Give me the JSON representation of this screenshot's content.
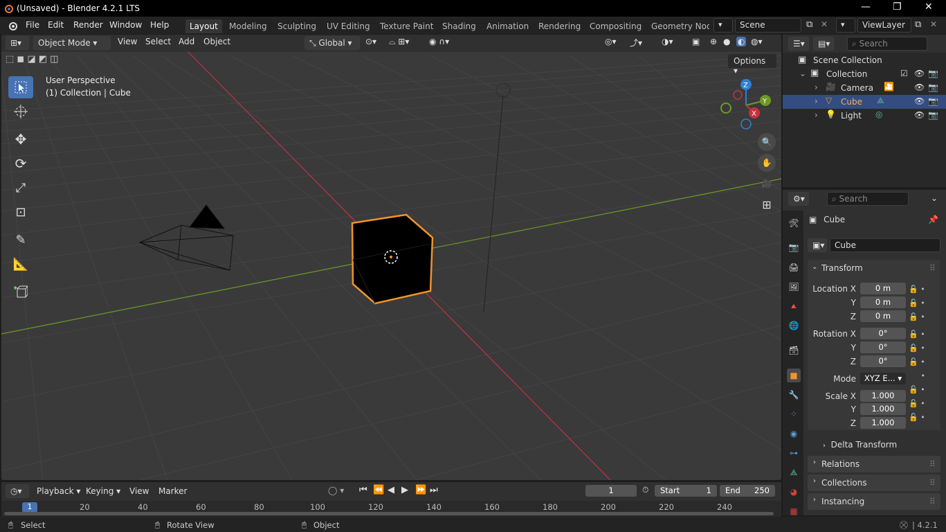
{
  "window": {
    "title": "(Unsaved) - Blender 4.2.1 LTS",
    "minimize": "—",
    "maximize": "❐",
    "close": "✕"
  },
  "menu": {
    "file": "File",
    "edit": "Edit",
    "render": "Render",
    "window": "Window",
    "help": "Help"
  },
  "workspaces": [
    "Layout",
    "Modeling",
    "Sculpting",
    "UV Editing",
    "Texture Paint",
    "Shading",
    "Animation",
    "Rendering",
    "Compositing",
    "Geometry Node"
  ],
  "scene": {
    "name": "Scene",
    "view_layer": "ViewLayer"
  },
  "viewport_header": {
    "mode": "Object Mode",
    "view": "View",
    "select": "Select",
    "add": "Add",
    "object": "Object",
    "orientation": "Global",
    "options": "Options"
  },
  "viewport": {
    "perspective": "User Perspective",
    "context": "(1) Collection | Cube"
  },
  "gizmo": {
    "x": "X",
    "y": "Y",
    "z": "Z"
  },
  "outliner": {
    "search_placeholder": "Search",
    "scene_collection": "Scene Collection",
    "collection": "Collection",
    "items": [
      {
        "label": "Camera",
        "selected": false
      },
      {
        "label": "Cube",
        "selected": true
      },
      {
        "label": "Light",
        "selected": false
      }
    ]
  },
  "properties": {
    "search_placeholder": "Search",
    "object_name": "Cube",
    "data_name": "Cube",
    "transform_label": "Transform",
    "location": {
      "label": "Location X",
      "x": "0 m",
      "y": "0 m",
      "z": "0 m"
    },
    "rotation": {
      "label": "Rotation X",
      "x": "0°",
      "y": "0°",
      "z": "0°"
    },
    "mode": {
      "label": "Mode",
      "value": "XYZ E..."
    },
    "scale": {
      "label": "Scale X",
      "x": "1.000",
      "y": "1.000",
      "z": "1.000"
    },
    "axis_y": "Y",
    "axis_z": "Z",
    "delta_transform": "Delta Transform",
    "relations": "Relations",
    "collections": "Collections",
    "instancing": "Instancing"
  },
  "timeline": {
    "playback": "Playback",
    "keying": "Keying",
    "view": "View",
    "marker": "Marker",
    "current_frame": "1",
    "start_label": "Start",
    "start": "1",
    "end_label": "End",
    "end": "250",
    "ruler_current": "1",
    "ruler": [
      "20",
      "40",
      "60",
      "80",
      "100",
      "120",
      "140",
      "160",
      "180",
      "200",
      "220",
      "240"
    ]
  },
  "status": {
    "select": "Select",
    "rotate_view": "Rotate View",
    "object": "Object",
    "version": "4.2.1"
  },
  "colors": {
    "accent": "#4772b3",
    "selection": "#f0932e",
    "x_axis": "#c5323e",
    "y_axis": "#6e9a24",
    "z_axis": "#2f7fd4"
  }
}
